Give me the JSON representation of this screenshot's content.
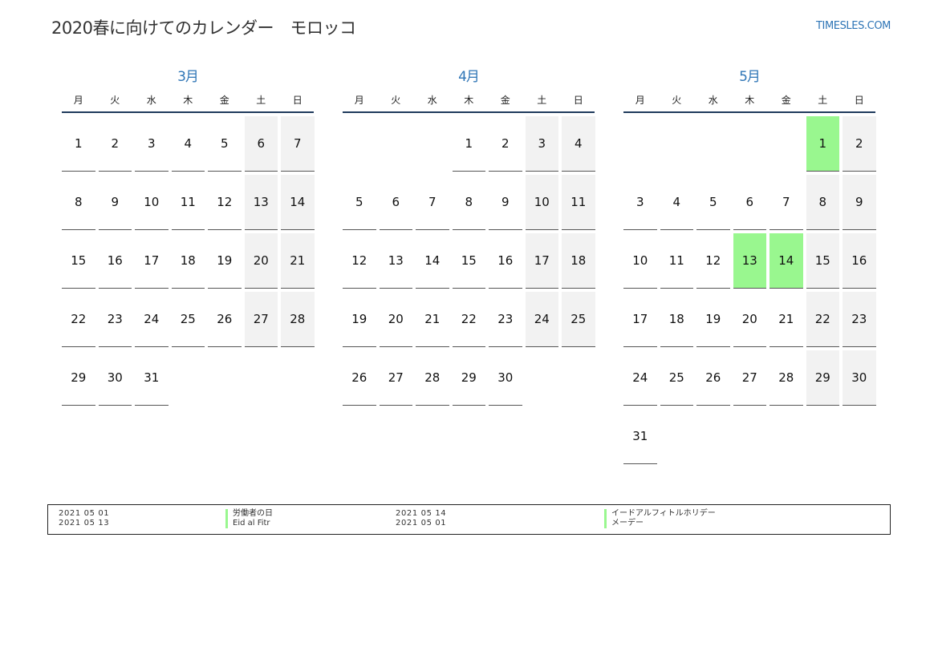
{
  "header": {
    "title": "2020春に向けてのカレンダー　モロッコ",
    "brand": "TIMESLES.COM"
  },
  "weekdays": [
    "月",
    "火",
    "水",
    "木",
    "金",
    "土",
    "日"
  ],
  "months": [
    {
      "name": "3月",
      "weeks": [
        [
          {
            "d": "1"
          },
          {
            "d": "2"
          },
          {
            "d": "3"
          },
          {
            "d": "4"
          },
          {
            "d": "5"
          },
          {
            "d": "6",
            "w": true
          },
          {
            "d": "7",
            "w": true
          }
        ],
        [
          {
            "d": "8"
          },
          {
            "d": "9"
          },
          {
            "d": "10"
          },
          {
            "d": "11"
          },
          {
            "d": "12"
          },
          {
            "d": "13",
            "w": true
          },
          {
            "d": "14",
            "w": true
          }
        ],
        [
          {
            "d": "15"
          },
          {
            "d": "16"
          },
          {
            "d": "17"
          },
          {
            "d": "18"
          },
          {
            "d": "19"
          },
          {
            "d": "20",
            "w": true
          },
          {
            "d": "21",
            "w": true
          }
        ],
        [
          {
            "d": "22"
          },
          {
            "d": "23"
          },
          {
            "d": "24"
          },
          {
            "d": "25"
          },
          {
            "d": "26"
          },
          {
            "d": "27",
            "w": true
          },
          {
            "d": "28",
            "w": true
          }
        ],
        [
          {
            "d": "29"
          },
          {
            "d": "30"
          },
          {
            "d": "31"
          },
          null,
          null,
          null,
          null
        ]
      ]
    },
    {
      "name": "4月",
      "weeks": [
        [
          null,
          null,
          null,
          {
            "d": "1"
          },
          {
            "d": "2"
          },
          {
            "d": "3",
            "w": true
          },
          {
            "d": "4",
            "w": true
          }
        ],
        [
          {
            "d": "5"
          },
          {
            "d": "6"
          },
          {
            "d": "7"
          },
          {
            "d": "8"
          },
          {
            "d": "9"
          },
          {
            "d": "10",
            "w": true
          },
          {
            "d": "11",
            "w": true
          }
        ],
        [
          {
            "d": "12"
          },
          {
            "d": "13"
          },
          {
            "d": "14"
          },
          {
            "d": "15"
          },
          {
            "d": "16"
          },
          {
            "d": "17",
            "w": true
          },
          {
            "d": "18",
            "w": true
          }
        ],
        [
          {
            "d": "19"
          },
          {
            "d": "20"
          },
          {
            "d": "21"
          },
          {
            "d": "22"
          },
          {
            "d": "23"
          },
          {
            "d": "24",
            "w": true
          },
          {
            "d": "25",
            "w": true
          }
        ],
        [
          {
            "d": "26"
          },
          {
            "d": "27"
          },
          {
            "d": "28"
          },
          {
            "d": "29"
          },
          {
            "d": "30"
          },
          null,
          null
        ]
      ]
    },
    {
      "name": "5月",
      "weeks": [
        [
          null,
          null,
          null,
          null,
          null,
          {
            "d": "1",
            "h": true
          },
          {
            "d": "2",
            "w": true
          }
        ],
        [
          {
            "d": "3"
          },
          {
            "d": "4"
          },
          {
            "d": "5"
          },
          {
            "d": "6"
          },
          {
            "d": "7"
          },
          {
            "d": "8",
            "w": true
          },
          {
            "d": "9",
            "w": true
          }
        ],
        [
          {
            "d": "10"
          },
          {
            "d": "11"
          },
          {
            "d": "12"
          },
          {
            "d": "13",
            "h": true
          },
          {
            "d": "14",
            "h": true
          },
          {
            "d": "15",
            "w": true
          },
          {
            "d": "16",
            "w": true
          }
        ],
        [
          {
            "d": "17"
          },
          {
            "d": "18"
          },
          {
            "d": "19"
          },
          {
            "d": "20"
          },
          {
            "d": "21"
          },
          {
            "d": "22",
            "w": true
          },
          {
            "d": "23",
            "w": true
          }
        ],
        [
          {
            "d": "24"
          },
          {
            "d": "25"
          },
          {
            "d": "26"
          },
          {
            "d": "27"
          },
          {
            "d": "28"
          },
          {
            "d": "29",
            "w": true
          },
          {
            "d": "30",
            "w": true
          }
        ],
        [
          {
            "d": "31"
          },
          null,
          null,
          null,
          null,
          null,
          null
        ]
      ]
    }
  ],
  "legend": {
    "col1_dates": [
      "2021 05 01",
      "2021 05 13"
    ],
    "col1_names": [
      "労働者の日",
      "Eid al Fitr"
    ],
    "col2_dates": [
      "2021 05 14",
      "2021 05 01"
    ],
    "col2_names": [
      "イードアルフィトルホリデー",
      "メーデー"
    ]
  },
  "colors": {
    "accent": "#2e75b6",
    "holiday": "#99f78f",
    "weekend": "#f2f2f2",
    "rule": "#1f3b5c"
  }
}
